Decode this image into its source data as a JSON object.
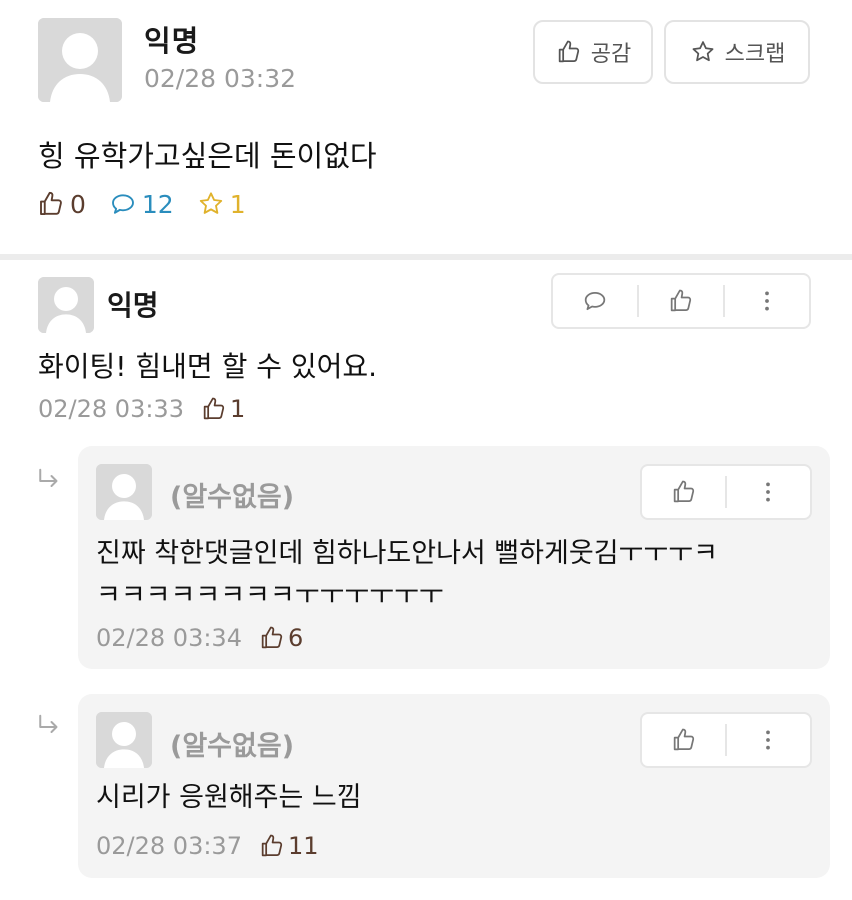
{
  "post": {
    "author": "익명",
    "time": "02/28 03:32",
    "like_button_label": "공감",
    "scrap_button_label": "스크랩",
    "body": "힝 유학가고싶은데 돈이없다",
    "stats": {
      "likes": "0",
      "comments": "12",
      "scraps": "1"
    }
  },
  "comment": {
    "author": "익명",
    "body": "화이팅! 힘내면 할 수 있어요.",
    "time": "02/28 03:33",
    "likes": "1"
  },
  "replies": [
    {
      "author": "(알수없음)",
      "body_line1": "진짜 착한댓글인데 힘하나도안나서 뻘하게웃김ㅜㅜㅜㅋ",
      "body_line2": "ㅋㅋㅋㅋㅋㅋㅋㅋㅜㅜㅜㅜㅜㅜ",
      "time": "02/28 03:34",
      "likes": "6"
    },
    {
      "author": "(알수없음)",
      "body_line1": "시리가 응원해주는 느낌",
      "time": "02/28 03:37",
      "likes": "11"
    }
  ],
  "colors": {
    "like": "#5b3d2e",
    "comment": "#2a8dbd",
    "scrap": "#e0b22c",
    "muted": "#9a9a9a"
  }
}
